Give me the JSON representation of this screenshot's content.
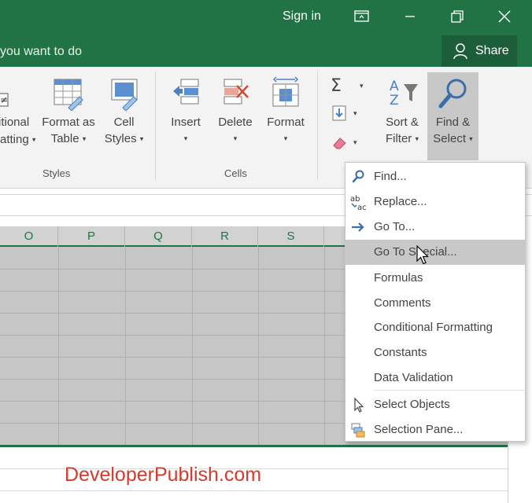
{
  "titlebar": {
    "signin": "Sign in",
    "icons": [
      "ribbon-display-icon",
      "minimize-icon",
      "restore-icon",
      "close-icon"
    ]
  },
  "tellme": {
    "text": "you want to do"
  },
  "share": {
    "label": "Share"
  },
  "ribbon": {
    "styles": {
      "conditional_line1": "itional",
      "conditional_line2": "atting",
      "format_table_line1": "Format as",
      "format_table_line2": "Table",
      "cell_styles_line1": "Cell",
      "cell_styles_line2": "Styles",
      "group_label": "Styles"
    },
    "cells": {
      "insert": "Insert",
      "delete": "Delete",
      "format": "Format",
      "group_label": "Cells"
    },
    "editing": {
      "sort_line1": "Sort &",
      "sort_line2": "Filter",
      "find_line1": "Find &",
      "find_line2": "Select"
    }
  },
  "columns": [
    "O",
    "P",
    "Q",
    "R",
    "S"
  ],
  "menu": {
    "items": [
      {
        "label": "Find...",
        "icon": "find-icon"
      },
      {
        "label": "Replace...",
        "icon": "replace-icon"
      },
      {
        "label": "Go To...",
        "icon": "goto-arrow-icon"
      },
      {
        "label": "Go To Special...",
        "icon": ""
      },
      {
        "label": "Formulas",
        "icon": ""
      },
      {
        "label": "Comments",
        "icon": ""
      },
      {
        "label": "Conditional Formatting",
        "icon": ""
      },
      {
        "label": "Constants",
        "icon": ""
      },
      {
        "label": "Data Validation",
        "icon": ""
      },
      {
        "label": "Select Objects",
        "icon": "select-objects-icon"
      },
      {
        "label": "Selection Pane...",
        "icon": "selection-pane-icon"
      }
    ]
  },
  "watermark": "DeveloperPublish.com",
  "colors": {
    "accent": "#217346",
    "highlight": "#c8c8c8",
    "grid_selection": "#c6c6c6"
  }
}
